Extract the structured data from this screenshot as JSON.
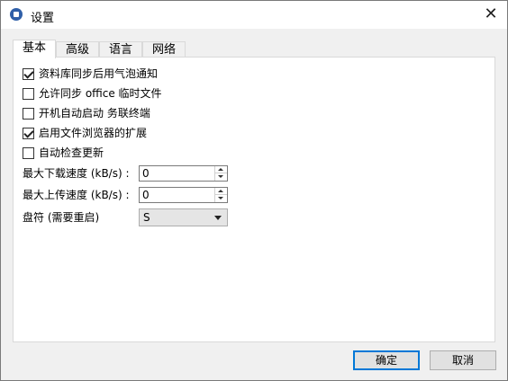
{
  "window": {
    "title": "设置",
    "close_glyph": "✕"
  },
  "tabs": [
    {
      "label": "基本",
      "active": true
    },
    {
      "label": "高级",
      "active": false
    },
    {
      "label": "语言",
      "active": false
    },
    {
      "label": "网络",
      "active": false
    }
  ],
  "options": [
    {
      "label": "资料库同步后用气泡通知",
      "checked": true
    },
    {
      "label": "允许同步 office 临时文件",
      "checked": false
    },
    {
      "label": "开机自动启动 务联终端",
      "checked": false
    },
    {
      "label": "启用文件浏览器的扩展",
      "checked": true
    },
    {
      "label": "自动检查更新",
      "checked": false
    }
  ],
  "fields": {
    "download_label": "最大下载速度 (kB/s) :",
    "download_value": "0",
    "upload_label": "最大上传速度 (kB/s) :",
    "upload_value": "0",
    "drive_label": "盘符 (需要重启)",
    "drive_value": "S"
  },
  "buttons": {
    "ok": "确定",
    "cancel": "取消"
  },
  "colors": {
    "accent": "#0078d7",
    "panel_bg": "#ffffff",
    "window_bg": "#f0f0f0"
  }
}
